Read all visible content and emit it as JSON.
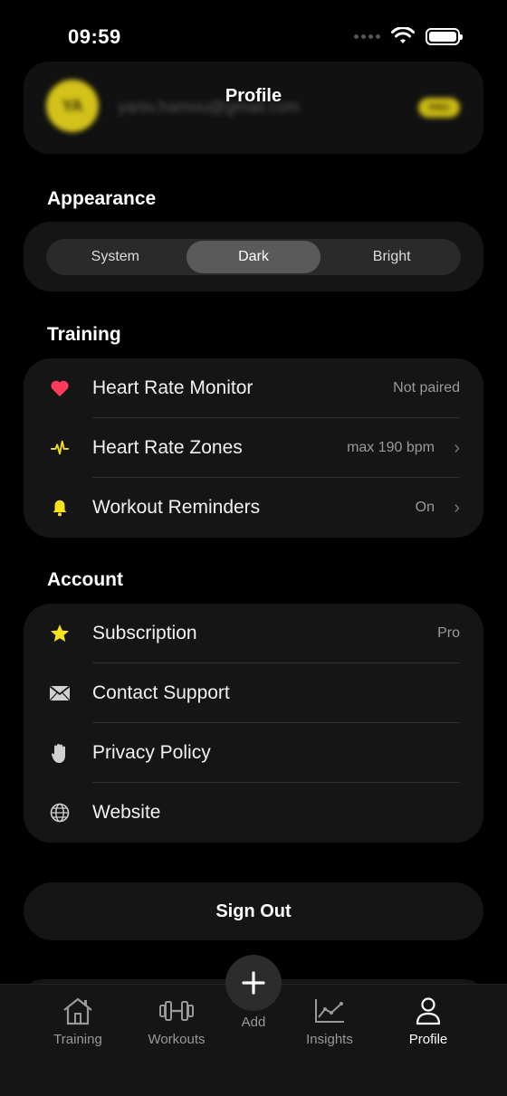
{
  "status_bar": {
    "time": "09:59"
  },
  "header": {
    "title": "Profile",
    "avatar_initials": "YA",
    "email": "yaniv.hamou@gmail.com",
    "badge": "PRO"
  },
  "appearance": {
    "title": "Appearance",
    "options": [
      "System",
      "Dark",
      "Bright"
    ],
    "selected": "Dark"
  },
  "training": {
    "title": "Training",
    "rows": [
      {
        "label": "Heart Rate Monitor",
        "value": "Not paired",
        "icon": "heart-icon"
      },
      {
        "label": "Heart Rate Zones",
        "value": "max 190 bpm",
        "icon": "pulse-icon"
      },
      {
        "label": "Workout Reminders",
        "value": "On",
        "icon": "bell-icon"
      }
    ]
  },
  "account": {
    "title": "Account",
    "rows": [
      {
        "label": "Subscription",
        "value": "Pro",
        "icon": "star-icon"
      },
      {
        "label": "Contact Support",
        "value": "",
        "icon": "envelope-icon"
      },
      {
        "label": "Privacy Policy",
        "value": "",
        "icon": "hand-icon"
      },
      {
        "label": "Website",
        "value": "",
        "icon": "globe-icon"
      }
    ]
  },
  "sign_out": "Sign Out",
  "tabs": [
    {
      "label": "Training",
      "icon": "house-icon"
    },
    {
      "label": "Workouts",
      "icon": "dumbbell-icon"
    },
    {
      "label": "Add",
      "icon": "plus-icon"
    },
    {
      "label": "Insights",
      "icon": "chart-icon"
    },
    {
      "label": "Profile",
      "icon": "person-icon"
    }
  ],
  "colors": {
    "accent_yellow": "#f5e21b",
    "heart_red": "#ff3b5c",
    "card_bg": "#151515"
  }
}
